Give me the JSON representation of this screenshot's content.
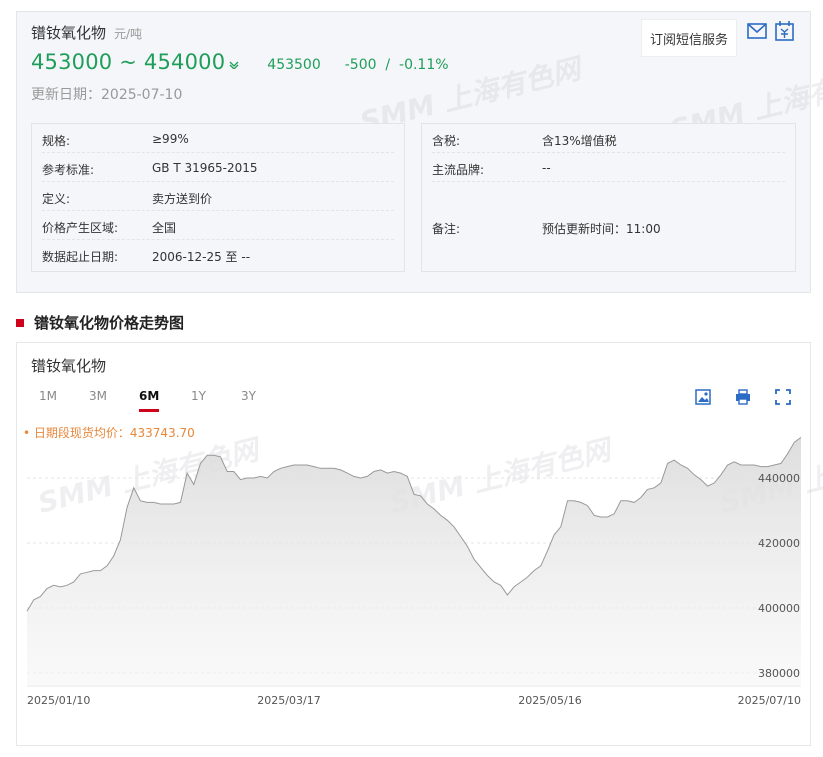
{
  "product": {
    "name": "镨钕氧化物",
    "unit": "元/吨",
    "price_range": "453000 ~ 454000",
    "avg_price": "453500",
    "change": "-500  /  -0.11%",
    "update_date": "更新日期：2025-07-10",
    "subscribe_label": "订阅短信服务"
  },
  "specs_left": [
    {
      "label": "规格:",
      "value": "≥99%"
    },
    {
      "label": "参考标准:",
      "value": "GB T 31965-2015"
    },
    {
      "label": "定义:",
      "value": "卖方送到价"
    },
    {
      "label": "价格产生区域:",
      "value": "全国"
    },
    {
      "label": "数据起止日期:",
      "value": "2006-12-25 至 --"
    }
  ],
  "specs_right": [
    {
      "label": "含税:",
      "value": "含13%增值税"
    },
    {
      "label": "主流品牌:",
      "value": "--"
    },
    {
      "label": "备注:",
      "value": "预估更新时间：11:00"
    }
  ],
  "section_title": "镨钕氧化物价格走势图",
  "chart_title": "镨钕氧化物",
  "range_tabs": [
    "1M",
    "3M",
    "6M",
    "1Y",
    "3Y"
  ],
  "active_tab": "6M",
  "watermark": "SMM 上海有色网",
  "colors": {
    "price_green": "#1f9e5a",
    "accent_red": "#d0021b",
    "avg_orange": "#e8873a",
    "line": "#999999"
  },
  "icons": [
    "mail-icon",
    "calendar-icon",
    "download-image-icon",
    "print-icon",
    "fullscreen-icon",
    "arrow-down-icon"
  ],
  "chart_data": {
    "type": "area",
    "title": "",
    "annotation": "• 日期段现货均价：433743.70",
    "x_ticks": [
      "2025/01/10",
      "2025/03/17",
      "2025/05/16",
      "2025/07/10"
    ],
    "y_ticks": [
      440000,
      420000,
      400000,
      380000
    ],
    "ylim": [
      376000,
      452000
    ],
    "grid": true,
    "series": [
      {
        "values": [
          399000,
          402500,
          403500,
          406000,
          407000,
          406500,
          407000,
          408000,
          410500,
          411000,
          411500,
          411500,
          413000,
          416000,
          421000,
          431000,
          437000,
          433000,
          432500,
          432500,
          432000,
          432000,
          432000,
          432500,
          441500,
          438000,
          444500,
          447000,
          447000,
          446500,
          442000,
          442000,
          439500,
          440000,
          440000,
          440500,
          440000,
          442000,
          443000,
          443500,
          444000,
          444000,
          444000,
          443500,
          443000,
          443000,
          443000,
          442500,
          441500,
          440500,
          440000,
          440500,
          442000,
          442500,
          441500,
          442000,
          441500,
          440500,
          435000,
          434500,
          432000,
          430500,
          428500,
          427000,
          425000,
          422000,
          419000,
          415000,
          412500,
          410000,
          408000,
          407000,
          404000,
          406500,
          408000,
          409500,
          411500,
          413000,
          417500,
          422500,
          425000,
          433000,
          433000,
          432500,
          431500,
          428500,
          428000,
          428000,
          429000,
          433000,
          433000,
          432500,
          434000,
          436500,
          437000,
          438500,
          444500,
          445500,
          444000,
          443000,
          441000,
          439500,
          437500,
          438500,
          441000,
          444000,
          445000,
          444000,
          444000,
          444000,
          443500,
          443500,
          444000,
          444500,
          447500,
          451000,
          452500
        ]
      }
    ]
  }
}
